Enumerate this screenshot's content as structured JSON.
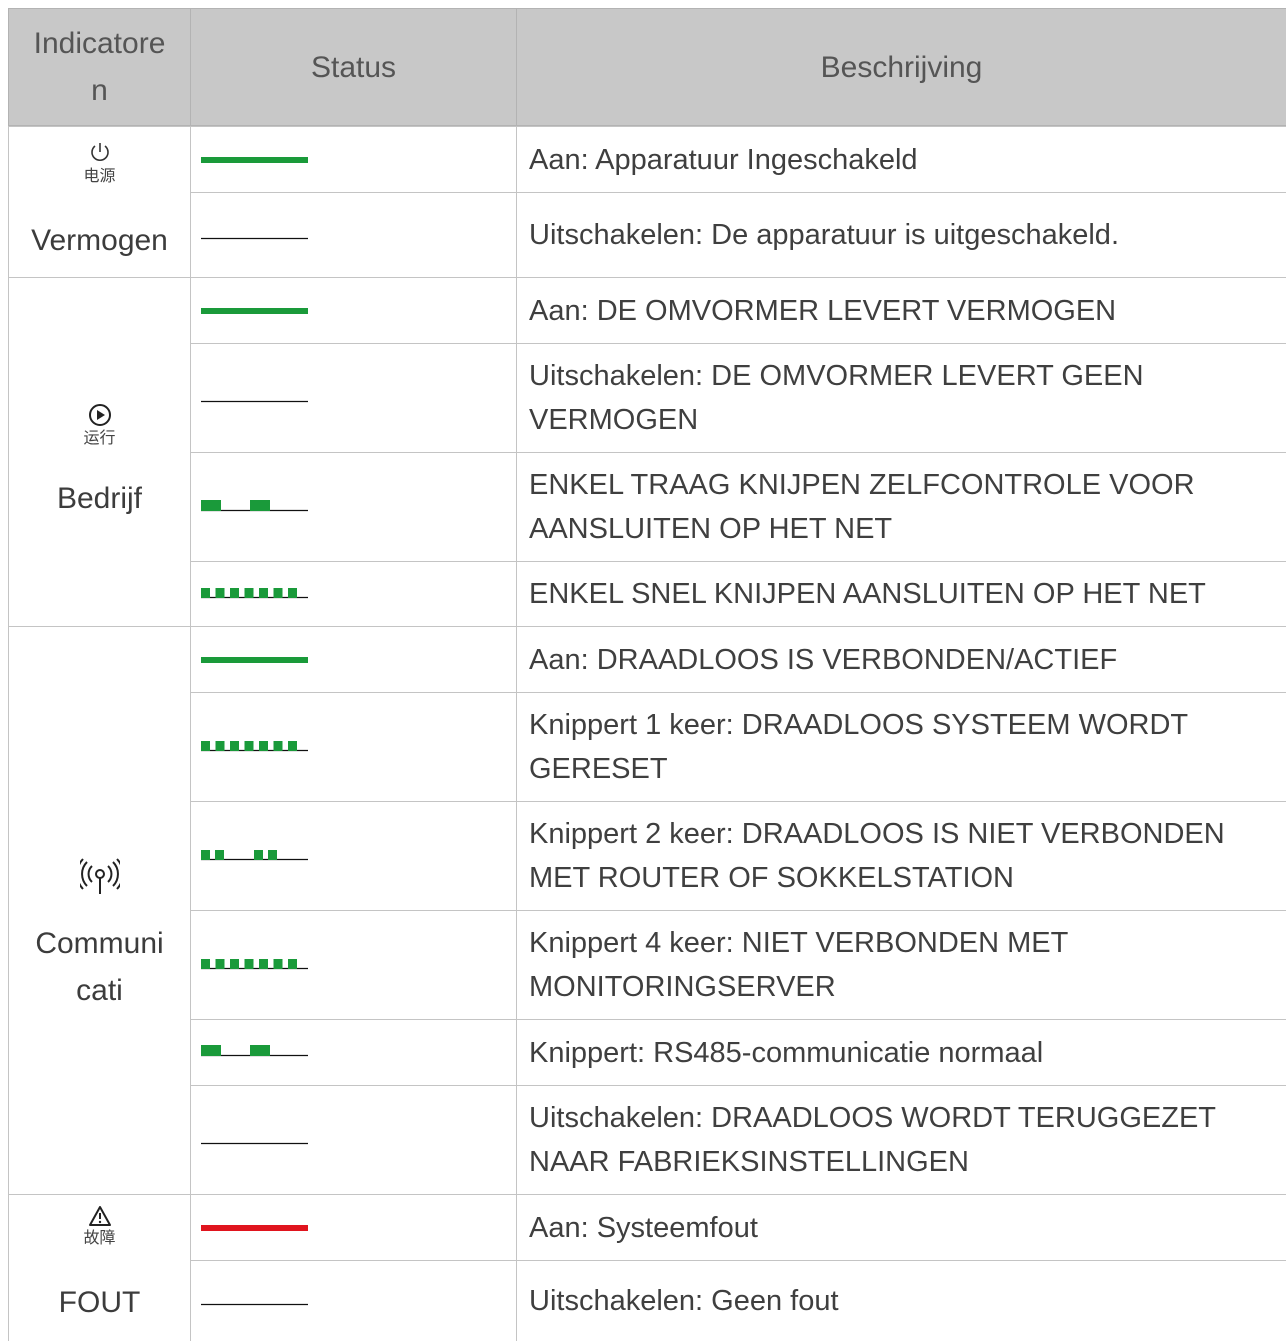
{
  "header": {
    "indicator": "Indicatore n",
    "indicator_line1": "Indicatore",
    "indicator_line2": "n",
    "status": "Status",
    "description": "Beschrijving"
  },
  "colors": {
    "green": "#1a9a3a",
    "red": "#e0141e",
    "header_bg": "#c8c8c8"
  },
  "groups": [
    {
      "icon": "power-icon",
      "icon_caption": "电源",
      "name_lines": [
        "Vermogen"
      ],
      "rows": [
        {
          "led": "solid-green",
          "text": "Aan: Apparatuur Ingeschakeld"
        },
        {
          "led": "off",
          "text": "Uitschakelen: De apparatuur is uitgeschakeld."
        }
      ]
    },
    {
      "icon": "play-icon",
      "icon_caption": "运行",
      "name_lines": [
        "Bedrijf"
      ],
      "rows": [
        {
          "led": "solid-green",
          "text": "Aan: DE OMVORMER LEVERT VERMOGEN"
        },
        {
          "led": "off",
          "text": "Uitschakelen: DE OMVORMER LEVERT GEEN VERMOGEN"
        },
        {
          "led": "slow-blink-green",
          "text": "ENKEL TRAAG KNIJPEN ZELFCONTROLE VOOR AANSLUITEN OP HET NET"
        },
        {
          "led": "fast-blink-green",
          "text": "ENKEL SNEL KNIJPEN AANSLUITEN OP HET NET"
        }
      ]
    },
    {
      "icon": "wireless-signal-icon",
      "icon_caption": "",
      "name_lines": [
        "Communi",
        "cati"
      ],
      "rows": [
        {
          "led": "solid-green",
          "text": "Aan: DRAADLOOS IS VERBONDEN/ACTIEF"
        },
        {
          "led": "fast-blink-green",
          "text": "Knippert 1 keer: DRAADLOOS SYSTEEM WORDT GERESET"
        },
        {
          "led": "double-blink-green",
          "text": "Knippert 2 keer: DRAADLOOS IS NIET VERBONDEN MET ROUTER OF SOKKELSTATION"
        },
        {
          "led": "fast-blink-green",
          "text": "Knippert 4 keer: NIET VERBONDEN MET MONITORINGSERVER"
        },
        {
          "led": "slow-blink-green",
          "text": "Knippert: RS485-communicatie normaal"
        },
        {
          "led": "off",
          "text": "Uitschakelen: DRAADLOOS WORDT TERUGGEZET NAAR FABRIEKSINSTELLINGEN"
        }
      ]
    },
    {
      "icon": "warning-icon",
      "icon_caption": "故障",
      "name_lines": [
        "FOUT"
      ],
      "rows": [
        {
          "led": "solid-red",
          "text": "Aan: Systeemfout"
        },
        {
          "led": "off",
          "text": "Uitschakelen: Geen fout"
        }
      ]
    }
  ]
}
